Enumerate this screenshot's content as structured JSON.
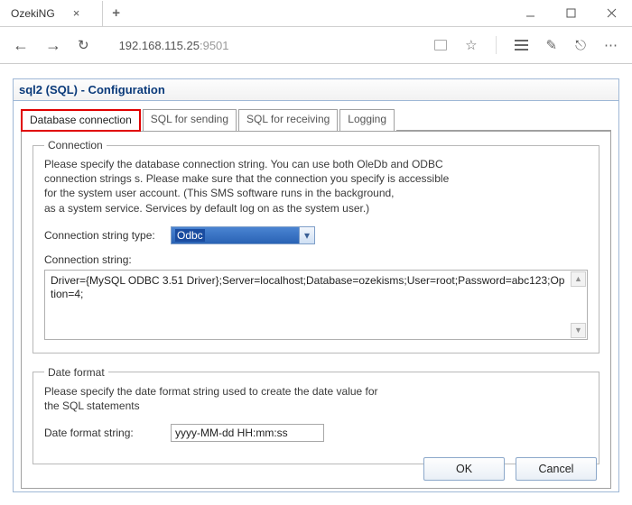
{
  "browser": {
    "tab_title": "OzekiNG",
    "address_host": "192.168.115.25",
    "address_port": ":9501"
  },
  "window_title": "sql2 (SQL) - Configuration",
  "tabs": [
    "Database connection",
    "SQL for sending",
    "SQL for receiving",
    "Logging"
  ],
  "connection": {
    "legend": "Connection",
    "description_lines": [
      "Please specify the database connection string. You can use both OleDb and ODBC",
      "connection strings s. Please make sure that the connection you specify is accessible",
      "for the system user account. (This SMS software runs in the background,",
      "as a system service. Services by default log on as the system user.)"
    ],
    "type_label": "Connection string type:",
    "type_value": "Odbc",
    "string_label": "Connection string:",
    "string_value": "Driver={MySQL ODBC 3.51 Driver};Server=localhost;Database=ozekisms;User=root;Password=abc123;Option=4;"
  },
  "date_format": {
    "legend": "Date format",
    "description_lines": [
      "Please specify the date format string used to create the date value for",
      "the SQL statements"
    ],
    "label": "Date format string:",
    "value": "yyyy-MM-dd HH:mm:ss"
  },
  "buttons": {
    "ok": "OK",
    "cancel": "Cancel"
  }
}
